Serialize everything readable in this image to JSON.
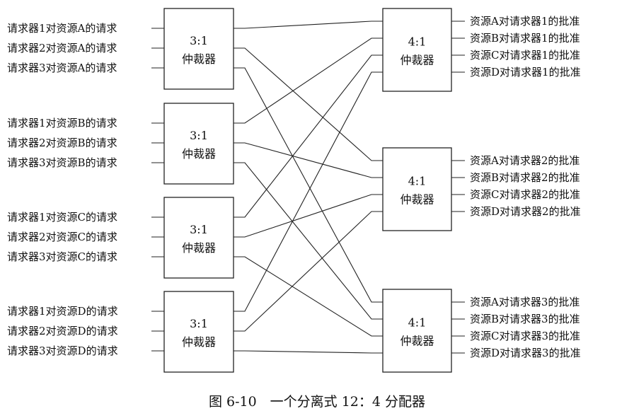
{
  "requests": [
    [
      "请求器1对资源A的请求",
      "请求器2对资源A的请求",
      "请求器3对资源A的请求"
    ],
    [
      "请求器1对资源B的请求",
      "请求器2对资源B的请求",
      "请求器3对资源B的请求"
    ],
    [
      "请求器1对资源C的请求",
      "请求器2对资源C的请求",
      "请求器3对资源C的请求"
    ],
    [
      "请求器1对资源D的请求",
      "请求器2对资源D的请求",
      "请求器3对资源D的请求"
    ]
  ],
  "input_arbiters": [
    {
      "ratio": "3:1",
      "name": "仲裁器"
    },
    {
      "ratio": "3:1",
      "name": "仲裁器"
    },
    {
      "ratio": "3:1",
      "name": "仲裁器"
    },
    {
      "ratio": "3:1",
      "name": "仲裁器"
    }
  ],
  "output_arbiters": [
    {
      "ratio": "4:1",
      "name": "仲裁器"
    },
    {
      "ratio": "4:1",
      "name": "仲裁器"
    },
    {
      "ratio": "4:1",
      "name": "仲裁器"
    }
  ],
  "grants": [
    [
      "资源A对请求器1的批准",
      "资源B对请求器1的批准",
      "资源C对请求器1的批准",
      "资源D对请求器1的批准"
    ],
    [
      "资源A对请求器2的批准",
      "资源B对请求器2的批准",
      "资源C对请求器2的批准",
      "资源D对请求器2的批准"
    ],
    [
      "资源A对请求器3的批准",
      "资源B对请求器3的批准",
      "资源C对请求器3的批准",
      "资源D对请求器3的批准"
    ]
  ],
  "caption": "图 6-10　一个分离式 12：4 分配器"
}
